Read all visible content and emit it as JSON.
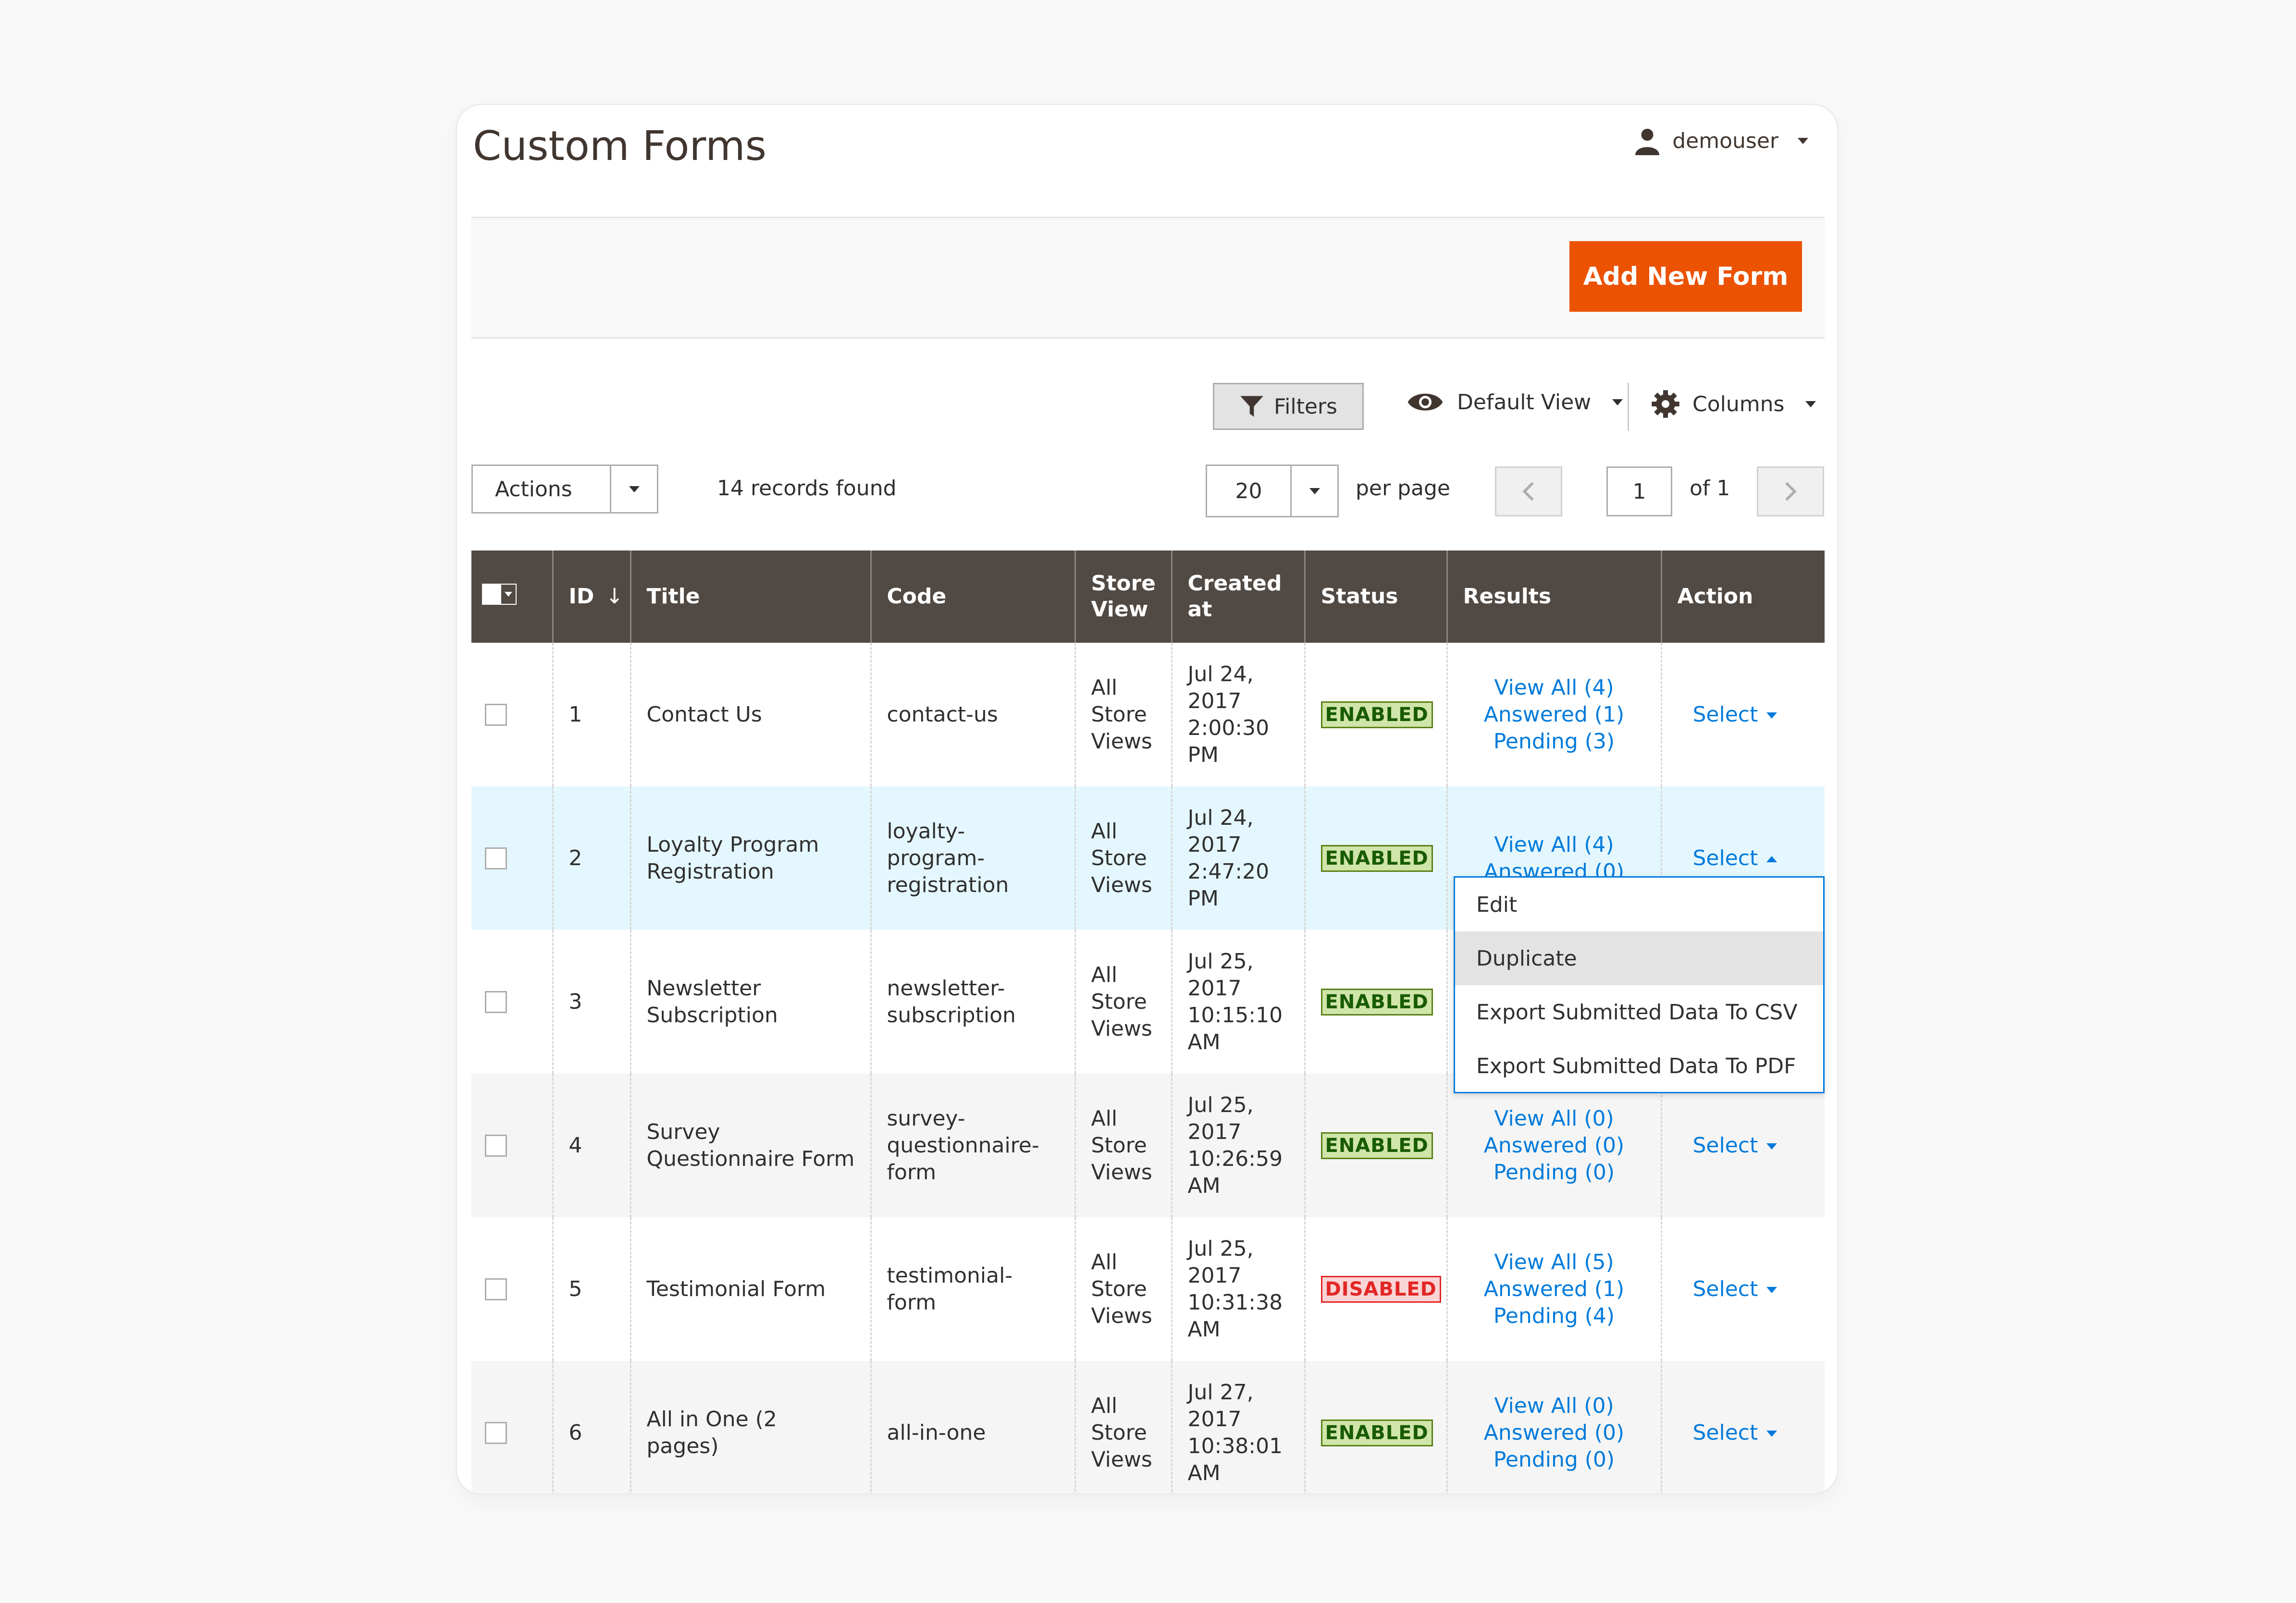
{
  "header": {
    "title": "Custom Forms",
    "user": "demouser"
  },
  "toolbar": {
    "add_label": "Add New Form"
  },
  "controls": {
    "filters_label": "Filters",
    "view_label": "Default View",
    "columns_label": "Columns",
    "actions_label": "Actions",
    "records_found": "14 records found",
    "per_page_value": "20",
    "per_page_label": "per page",
    "page_value": "1",
    "page_of": "of 1"
  },
  "columns": [
    "ID",
    "Title",
    "Code",
    "Store View",
    "Created at",
    "Status",
    "Results",
    "Action"
  ],
  "rows": [
    {
      "id": "1",
      "title": "Contact Us",
      "code": "contact-us",
      "store": [
        "All",
        "Store",
        "Views"
      ],
      "created": [
        "Jul 24,",
        "2017",
        "2:00:30",
        "PM"
      ],
      "status": "ENABLED",
      "results": [
        "View All (4)",
        "Answered (1)",
        "Pending (3)"
      ],
      "action": "Select"
    },
    {
      "id": "2",
      "title": "Loyalty Program Registration",
      "code": "loyalty-program-registration",
      "store": [
        "All",
        "Store",
        "Views"
      ],
      "created": [
        "Jul 24,",
        "2017",
        "2:47:20",
        "PM"
      ],
      "status": "ENABLED",
      "results": [
        "View All (4)",
        "Answered (0)"
      ],
      "action": "Select"
    },
    {
      "id": "3",
      "title": "Newsletter Subscription",
      "code": "newsletter-subscription",
      "store": [
        "All",
        "Store",
        "Views"
      ],
      "created": [
        "Jul 25,",
        "2017",
        "10:15:10",
        "AM"
      ],
      "status": "ENABLED",
      "results": [],
      "action": ""
    },
    {
      "id": "4",
      "title": "Survey Questionnaire Form",
      "code": "survey-questionnaire-form",
      "store": [
        "All",
        "Store",
        "Views"
      ],
      "created": [
        "Jul 25,",
        "2017",
        "10:26:59",
        "AM"
      ],
      "status": "ENABLED",
      "results": [
        "View All (0)",
        "Answered (0)",
        "Pending (0)"
      ],
      "action": "Select"
    },
    {
      "id": "5",
      "title": "Testimonial Form",
      "code": "testimonial-form",
      "store": [
        "All",
        "Store",
        "Views"
      ],
      "created": [
        "Jul 25,",
        "2017",
        "10:31:38",
        "AM"
      ],
      "status": "DISABLED",
      "results": [
        "View All (5)",
        "Answered (1)",
        "Pending (4)"
      ],
      "action": "Select"
    },
    {
      "id": "6",
      "title": "All in One (2 pages)",
      "code": "all-in-one",
      "store": [
        "All",
        "Store",
        "Views"
      ],
      "created": [
        "Jul 27,",
        "2017",
        "10:38:01",
        "AM"
      ],
      "status": "ENABLED",
      "results": [
        "View All (0)",
        "Answered (0)",
        "Pending (0)"
      ],
      "action": "Select"
    }
  ],
  "dropdown": {
    "options": [
      "Edit",
      "Duplicate",
      "Export Submitted Data To CSV",
      "Export Submitted Data To PDF"
    ],
    "highlighted": "Duplicate"
  },
  "colors": {
    "accent": "#eb5202",
    "header_bg": "#514943",
    "link": "#007bdb",
    "hover_row": "#e5f7fe"
  }
}
